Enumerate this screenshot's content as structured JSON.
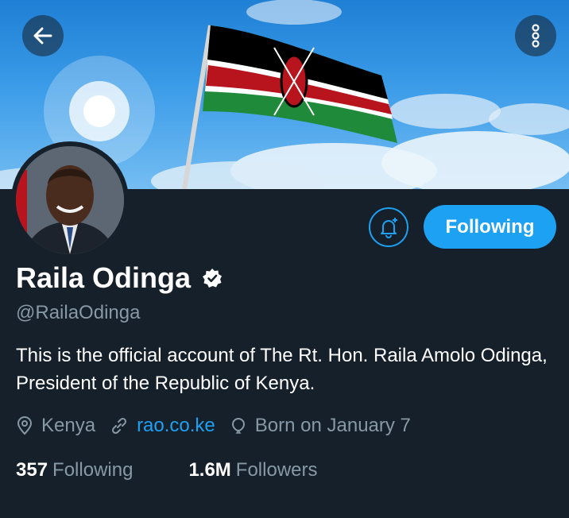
{
  "header": {
    "back_icon": "arrow-left-icon",
    "more_icon": "more-vertical-icon",
    "banner_description_colors": {
      "sky": "#3a9be8",
      "flag_black": "#000000",
      "flag_red": "#b8141e",
      "flag_green": "#1f8a3a"
    }
  },
  "profile": {
    "name": "Raila Odinga",
    "handle": "@RailaOdinga",
    "bio": "This is the official account of The Rt. Hon. Raila Amolo Odinga, President of the Republic of Kenya.",
    "location": "Kenya",
    "website": "rao.co.ke",
    "birthday": "Born on January 7",
    "following_count": "357",
    "following_label": "Following",
    "followers_count": "1.6M",
    "followers_label": "Followers"
  },
  "actions": {
    "follow_button": "Following",
    "notify_icon": "bell-plus-icon"
  },
  "colors": {
    "accent": "#1da1f2",
    "background": "#15202b",
    "muted": "#8899a6"
  }
}
